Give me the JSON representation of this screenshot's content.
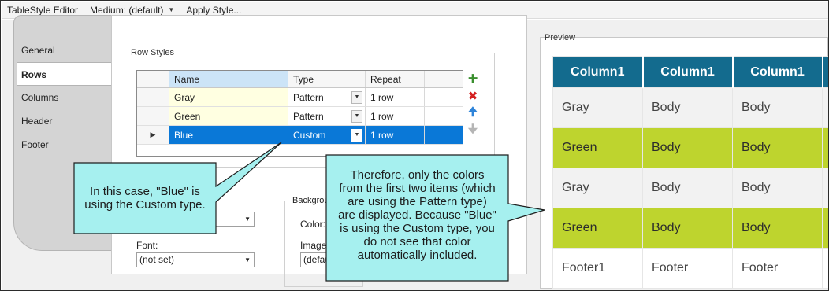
{
  "toolbar": {
    "title": "TableStyle Editor",
    "medium_select": "Medium: (default)",
    "apply_style": "Apply Style..."
  },
  "tabs": [
    {
      "label": "General"
    },
    {
      "label": "Rows"
    },
    {
      "label": "Columns"
    },
    {
      "label": "Header"
    },
    {
      "label": "Footer"
    }
  ],
  "row_styles": {
    "group_title": "Row Styles",
    "columns": [
      "Name",
      "Type",
      "Repeat"
    ],
    "rows": [
      {
        "name": "Gray",
        "type": "Pattern",
        "repeat": "1 row"
      },
      {
        "name": "Green",
        "type": "Pattern",
        "repeat": "1 row"
      },
      {
        "name": "Blue",
        "type": "Custom",
        "repeat": "1 row"
      }
    ],
    "selected_index": 2
  },
  "form": {
    "background_label": "Backgrou",
    "color_label": "Color:",
    "image_label": "Image:",
    "image_value": "(defau",
    "font_label": "Font:",
    "font_value": "(not set)"
  },
  "preview": {
    "title": "Preview",
    "header": [
      "Column1",
      "Column1",
      "Column1"
    ],
    "rows": [
      [
        "Gray",
        "Body",
        "Body"
      ],
      [
        "Green",
        "Body",
        "Body"
      ],
      [
        "Gray",
        "Body",
        "Body"
      ],
      [
        "Green",
        "Body",
        "Body"
      ],
      [
        "Footer1",
        "Footer",
        "Footer"
      ]
    ],
    "colors": {
      "header": "#136b8e",
      "gray": "#f2f2f2",
      "green": "#bed42e"
    }
  },
  "callouts": {
    "left": {
      "lines": [
        "In this case, \"Blue\" is",
        "using the Custom type."
      ]
    },
    "right": {
      "lines": [
        "Therefore, only the colors",
        "from the first two items (which",
        "are using the Pattern type)",
        "are displayed. Because \"Blue\"",
        "is using the Custom type, you",
        "do not see that color",
        "automatically included."
      ]
    },
    "fill": "#a6f0ef"
  }
}
